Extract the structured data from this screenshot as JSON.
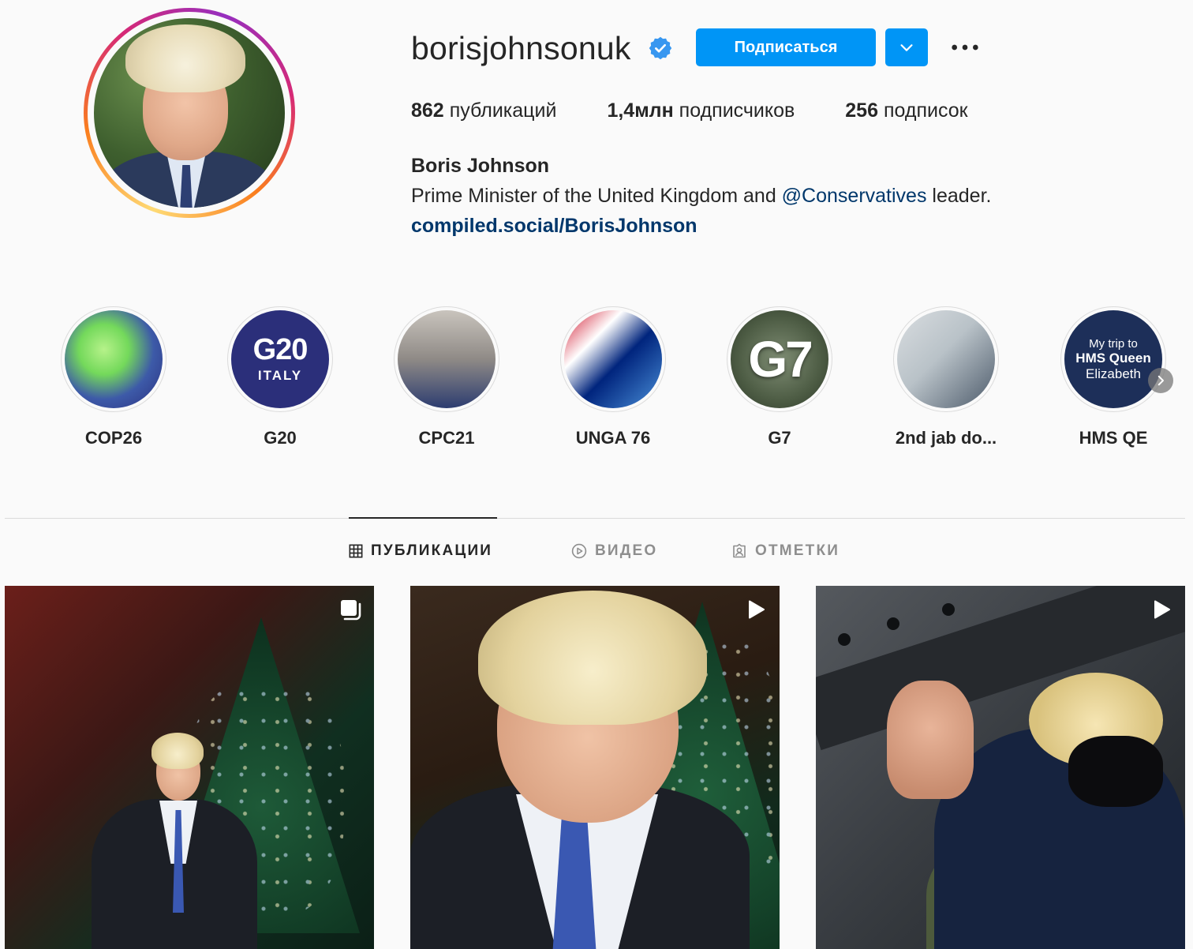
{
  "profile": {
    "username": "borisjohnsonuk",
    "verified": true,
    "follow_label": "Подписаться",
    "stats": {
      "posts_count": "862",
      "posts_label": "публикаций",
      "followers_count": "1,4млн",
      "followers_label": "подписчиков",
      "following_count": "256",
      "following_label": "подписок"
    },
    "full_name": "Boris Johnson",
    "bio_before": "Prime Minister of the United Kingdom and ",
    "bio_mention": "@Conservatives",
    "bio_after": " leader.",
    "link": "compiled.social/BorisJohnson"
  },
  "highlights": {
    "items": [
      {
        "label": "COP26"
      },
      {
        "label": "G20",
        "cover_text": "G20",
        "cover_subtext": "ITALY"
      },
      {
        "label": "CPC21"
      },
      {
        "label": "UNGA 76"
      },
      {
        "label": "G7",
        "cover_text": "G7"
      },
      {
        "label": "2nd jab do..."
      },
      {
        "label": "HMS QE",
        "cover_line1": "My trip to",
        "cover_line2": "HMS Queen",
        "cover_line3": "Elizabeth"
      }
    ]
  },
  "tabs": {
    "items": [
      {
        "label": "ПУБЛИКАЦИИ",
        "icon": "grid-icon",
        "active": true
      },
      {
        "label": "ВИДЕО",
        "icon": "play-circle-icon",
        "active": false
      },
      {
        "label": "ОТМЕТКИ",
        "icon": "tagged-user-icon",
        "active": false
      }
    ]
  },
  "posts": [
    {
      "type": "carousel",
      "badge_icon": "carousel-icon"
    },
    {
      "type": "video",
      "badge_icon": "play-icon"
    },
    {
      "type": "video",
      "badge_icon": "play-icon"
    }
  ],
  "colors": {
    "accent": "#0095f6",
    "link": "#00376b",
    "verified": "#3897f0",
    "text": "#262626",
    "muted": "#8e8e8e",
    "background": "#fafafa"
  }
}
